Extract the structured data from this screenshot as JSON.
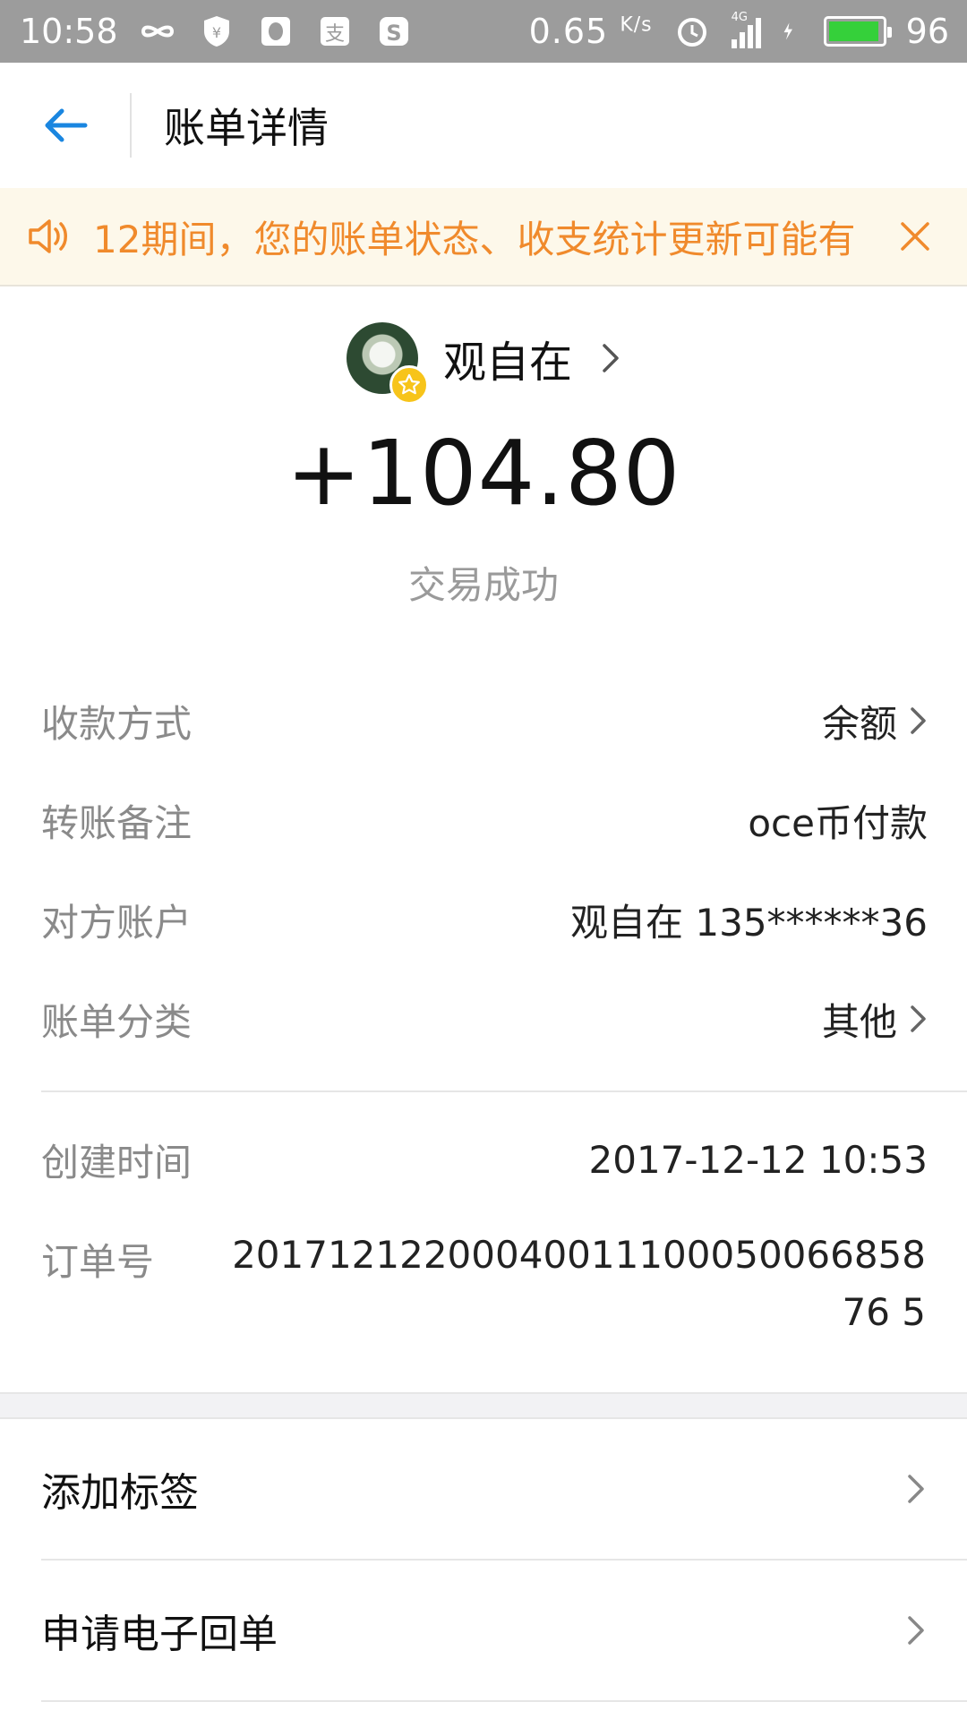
{
  "status_bar": {
    "time": "10:58",
    "speed": "0.65",
    "speed_unit": "K/s",
    "network": "4G",
    "battery": "96",
    "battery_color": "#35d03a"
  },
  "header": {
    "title": "账单详情",
    "accent": "#1a86e0"
  },
  "notice": {
    "text": "12期间，您的账单状态、收支统计更新可能有",
    "color": "#f08a2c",
    "background": "#fdf8ea"
  },
  "summary": {
    "payee_name": "观自在",
    "amount": "+104.80",
    "status": "交易成功"
  },
  "details": [
    {
      "label": "收款方式",
      "value": "余额",
      "has_chevron": true
    },
    {
      "label": "转账备注",
      "value": "oce币付款",
      "has_chevron": false
    },
    {
      "label": "对方账户",
      "value": "观自在 135******36",
      "has_chevron": false
    },
    {
      "label": "账单分类",
      "value": "其他",
      "has_chevron": true
    }
  ],
  "meta": {
    "created_label": "创建时间",
    "created_value": "2017-12-12 10:53",
    "order_label": "订单号",
    "order_value": "2017121220004001110005006685876 5"
  },
  "actions": [
    {
      "label": "添加标签"
    },
    {
      "label": "申请电子回单"
    }
  ],
  "icons": {
    "back": "arrow-left-icon",
    "speaker": "speaker-icon",
    "close": "close-icon",
    "chevron": "chevron-right-icon",
    "badge": "star-badge-icon"
  }
}
